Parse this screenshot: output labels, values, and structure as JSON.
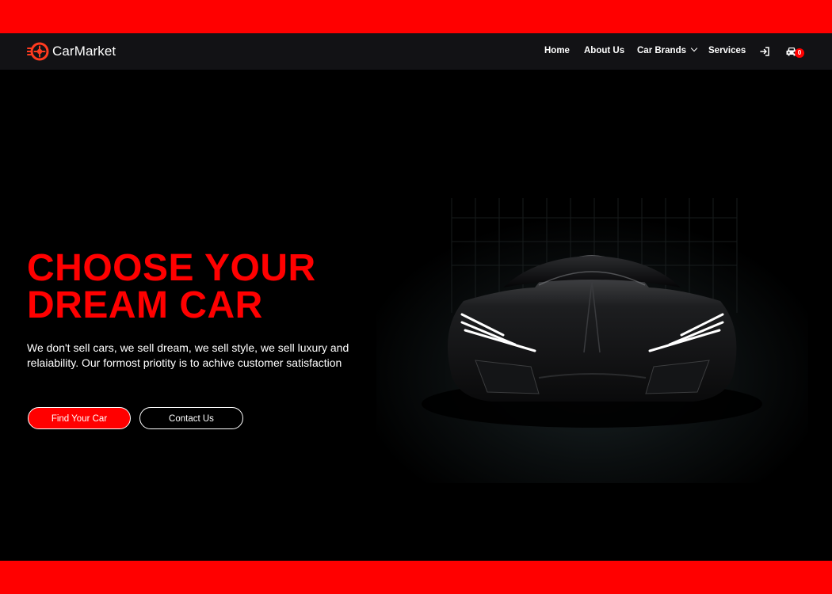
{
  "colors": {
    "accent": "#ff0000",
    "navbar_bg": "#121215",
    "page_bg": "#000000",
    "text": "#ffffff"
  },
  "brand": {
    "name": "CarMarket",
    "logo_icon": "wheel-logo-icon"
  },
  "nav": {
    "items": [
      {
        "label": "Home"
      },
      {
        "label": "About Us"
      },
      {
        "label": "Car Brands",
        "has_dropdown": true,
        "dropdown_icon": "chevron-down-icon"
      },
      {
        "label": "Services"
      }
    ],
    "login_icon": "login-icon",
    "cart": {
      "icon": "car-icon",
      "count": "0"
    }
  },
  "hero": {
    "title_line1": "CHOOSE YOUR",
    "title_line2": "DREAM CAR",
    "description": "We don't sell cars, we sell dream, we sell style, we sell luxury and relaiability. Our formost priotity is to achive customer satisfaction",
    "primary_button": "Find Your Car",
    "secondary_button": "Contact Us",
    "image": "sports-car-image"
  }
}
